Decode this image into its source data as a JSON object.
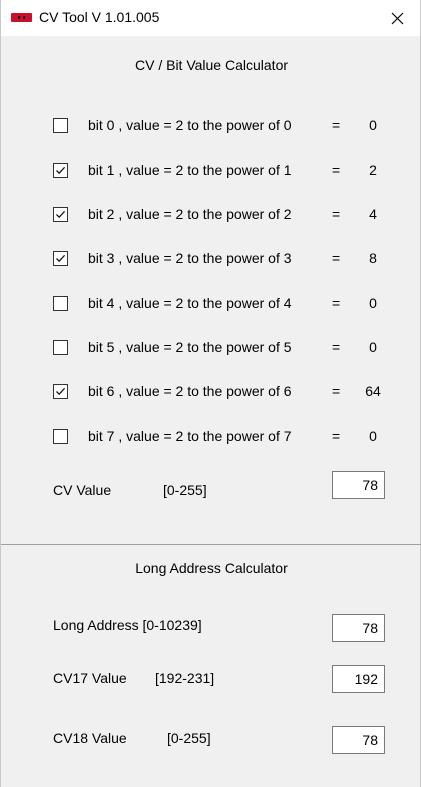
{
  "window": {
    "title": "CV Tool   V 1.01.005",
    "close_glyph": "close-icon"
  },
  "bit_calculator": {
    "title": "CV / Bit Value Calculator",
    "equals_sign": "=",
    "bits": [
      {
        "label": "bit 0 , value = 2 to the power of 0",
        "checked": false,
        "value": "0"
      },
      {
        "label": "bit 1 , value = 2 to the power of 1",
        "checked": true,
        "value": "2"
      },
      {
        "label": "bit 2 , value = 2 to the power of 2",
        "checked": true,
        "value": "4"
      },
      {
        "label": "bit 3 , value = 2 to the power of 3",
        "checked": true,
        "value": "8"
      },
      {
        "label": "bit 4 , value = 2 to the power of 4",
        "checked": false,
        "value": "0"
      },
      {
        "label": "bit 5 , value = 2 to the power of 5",
        "checked": false,
        "value": "0"
      },
      {
        "label": "bit 6 , value = 2 to the power of 6",
        "checked": true,
        "value": "64"
      },
      {
        "label": "bit 7 , value = 2 to the power of 7",
        "checked": false,
        "value": "0"
      }
    ],
    "cv_value_label": "CV Value",
    "cv_value_range": "[0-255]",
    "cv_value": "78"
  },
  "long_address": {
    "title": "Long Address Calculator",
    "long_address_label": "Long Address [0-10239]",
    "long_address_value": "78",
    "cv17_label": "CV17 Value",
    "cv17_range": "[192-231]",
    "cv17_value": "192",
    "cv18_label": "CV18 Value",
    "cv18_range": "[0-255]",
    "cv18_value": "78"
  }
}
